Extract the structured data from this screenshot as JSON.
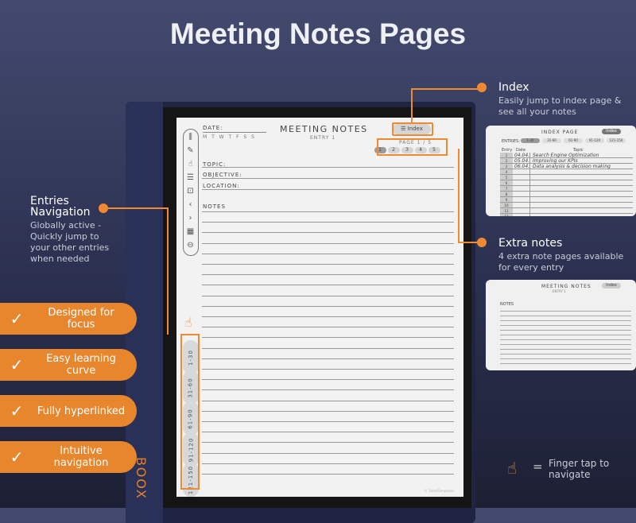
{
  "title": "Meeting Notes Pages",
  "colors": {
    "accent": "#f08a32",
    "background": "#2b3050",
    "paper": "#f2f2f2"
  },
  "brand": "BOOX",
  "left": {
    "heading": "Entries Navigation",
    "desc": "Globally active - Quickly jump to your other entries when needed"
  },
  "features": [
    "Designed for focus",
    "Easy learning curve",
    "Fully hyperlinked",
    "Intuitive navigation"
  ],
  "index_callout": {
    "heading": "Index",
    "desc": "Easily jump to index page & see all your notes"
  },
  "extra_callout": {
    "heading": "Extra notes",
    "desc": "4 extra note pages available for every entry"
  },
  "footer": {
    "icon": "finger-tap-icon",
    "eq": "=",
    "text": "Finger tap to navigate"
  },
  "page": {
    "date_label": "DATE:",
    "weekdays": "M T W T F S S",
    "heading": "MEETING NOTES",
    "entry": "ENTRY 1",
    "index_btn": "Index",
    "page_label": "PAGE 1 / 5",
    "pages": [
      "1",
      "2",
      "3",
      "4",
      "5"
    ],
    "current_page": 1,
    "fields": [
      "TOPIC:",
      "OBJECTIVE:",
      "LOCATION:"
    ],
    "notes_label": "NOTES",
    "entries": [
      "1-30",
      "31-60",
      "61-90",
      "91-120",
      "121-150"
    ],
    "toolbar_icons": [
      "split-icon",
      "pen-icon",
      "hand-icon",
      "list-icon",
      "zoom-icon",
      "chevron-left-icon",
      "chevron-right-icon",
      "calendar-icon",
      "more-icon"
    ],
    "watermark": "© TabletTemplates"
  },
  "index_thumb": {
    "title": "INDEX PAGE",
    "btn": "Index",
    "entries_label": "ENTRIES:",
    "ranges": [
      "1-30",
      "31-60",
      "61-90",
      "91-120",
      "121-150"
    ],
    "cols": [
      "Entry",
      "Date",
      "Topic"
    ],
    "rows": [
      [
        "1",
        "04.04.",
        "Search Engine Optimization"
      ],
      [
        "2",
        "05.04.",
        "Improving our KPIs"
      ],
      [
        "3",
        "06.04.",
        "Data analysis & decision making"
      ]
    ]
  },
  "extra_thumb": {
    "title": "MEETING NOTES",
    "entry": "ENTRY 1",
    "btn": "Index",
    "notes_label": "NOTES"
  }
}
